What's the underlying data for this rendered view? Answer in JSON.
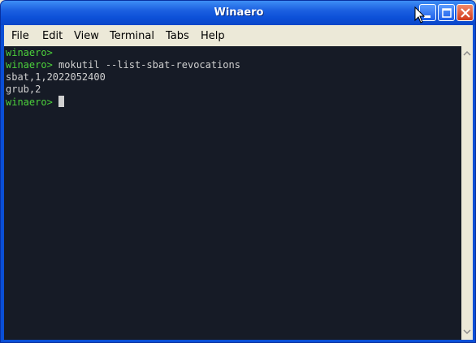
{
  "window": {
    "title": "Winaero"
  },
  "menu": {
    "file": "File",
    "edit": "Edit",
    "view": "View",
    "terminal": "Terminal",
    "tabs": "Tabs",
    "help": "Help"
  },
  "terminal": {
    "lines": [
      {
        "prompt": "winaero>",
        "text": ""
      },
      {
        "prompt": "winaero>",
        "text": " mokutil --list-sbat-revocations"
      },
      {
        "prompt": "",
        "text": "sbat,1,2022052400"
      },
      {
        "prompt": "",
        "text": "grub,2"
      },
      {
        "prompt": "winaero>",
        "text": " "
      }
    ]
  },
  "colors": {
    "prompt": "#4cd13b",
    "terminal_bg": "#161b26",
    "text": "#d0d0d0"
  },
  "icons": {
    "minimize": "minimize-icon",
    "maximize": "maximize-icon",
    "close": "close-icon"
  }
}
